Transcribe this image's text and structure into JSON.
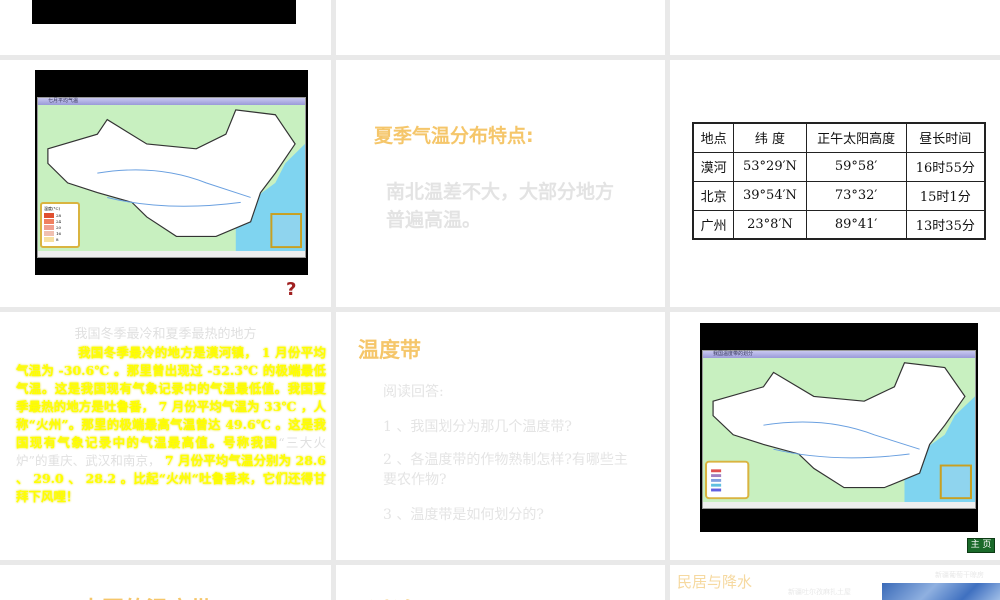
{
  "slides": {
    "s2": {
      "question_mark": "?",
      "map_window_title": "七月平均气温",
      "legend_title": "温度(°C)",
      "legend_values": [
        "28",
        "24",
        "20",
        "16",
        "8"
      ]
    },
    "s3": {
      "title": "夏季气温分布特点:",
      "body": "南北温差不大，大部分地方普遍高温。"
    },
    "s4": {
      "table": {
        "headers": [
          "地点",
          "纬 度",
          "正午太阳高度",
          "昼长时间"
        ],
        "rows": [
          [
            "漠河",
            "53°29′N",
            "59°58′",
            "16时55分"
          ],
          [
            "北京",
            "39°54′N",
            "73°32′",
            "15时1分"
          ],
          [
            "广州",
            "23°8′N",
            "89°41′",
            "13时35分"
          ]
        ]
      }
    },
    "s5": {
      "title": "我国冬季最冷和夏季最热的地方",
      "p1": "我国冬季最冷的地方是漠河镇， 1 月份平均气温为 -30.6℃ 。那里曾出现过 -52.3℃ 的极端最低气温。这是我国现有气象记录中的气温最低值。我国夏季最热的地方是吐鲁番， 7 月份平均气温为 33℃ ，人称“火州”。那里的极端最高气温曾达 49.6℃ 。这是我国现有气象记录中的气温最高值。号称我国",
      "p2": "“三大火炉”的重庆、武汉和南京，",
      "p3": " 7 月份平均气温分别为 28.6 、 29.0 、 28.2 。比起“火州“吐鲁番来，它们还得甘拜下风哩！"
    },
    "s6": {
      "title": "温度带",
      "intro": "阅读回答:",
      "questions": [
        "1 、我国划分为那几个温度带?",
        "2 、各温度带的作物熟制怎样?有哪些主要农作物?",
        "3 、温度带是如何划分的?"
      ]
    },
    "s7": {
      "map_window_title": "我国温度带的划分",
      "home_button": "主 页"
    },
    "s8": {
      "title": "中国的温度带"
    },
    "s9": {
      "title": "讨论"
    },
    "s10": {
      "title": "民居与降水",
      "caption1": "新疆葡萄干晾房",
      "caption2": "新疆吐尔孜麻扎土屋"
    }
  }
}
